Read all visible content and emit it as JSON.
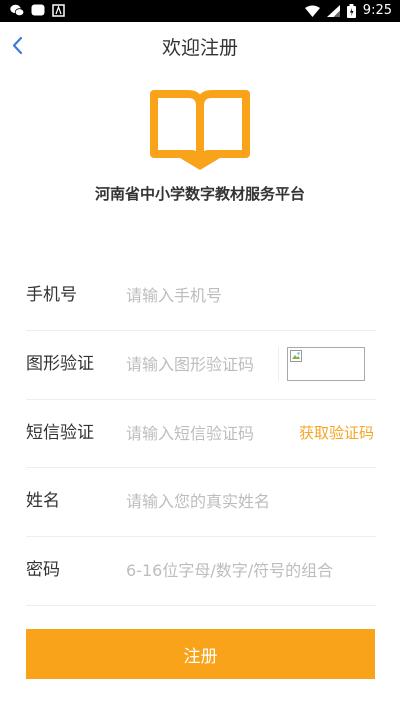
{
  "status_bar": {
    "time": "9:25",
    "left_icons": [
      "wechat-icon",
      "message-icon",
      "app-icon"
    ],
    "right_icons": [
      "wifi-icon",
      "signal-icon",
      "battery-icon"
    ]
  },
  "header": {
    "title": "欢迎注册",
    "back_icon": "chevron-left-icon"
  },
  "branding": {
    "logo_icon": "open-book-icon",
    "platform_name": "河南省中小学数字教材服务平台"
  },
  "form": {
    "phone": {
      "label": "手机号",
      "placeholder": "请输入手机号",
      "value": ""
    },
    "captcha": {
      "label": "图形验证",
      "placeholder": "请输入图形验证码",
      "value": "",
      "image_icon": "broken-image-icon"
    },
    "sms": {
      "label": "短信验证",
      "placeholder": "请输入短信验证码",
      "value": "",
      "get_code_label": "获取验证码"
    },
    "name": {
      "label": "姓名",
      "placeholder": "请输入您的真实姓名",
      "value": ""
    },
    "password": {
      "label": "密码",
      "placeholder": "6-16位字母/数字/符号的组合",
      "value": ""
    }
  },
  "actions": {
    "submit_label": "注册"
  },
  "colors": {
    "accent": "#f9a31a",
    "link": "#f5a623",
    "back_icon": "#3d7bd9",
    "text": "#333333",
    "placeholder": "#bdbdbd"
  }
}
